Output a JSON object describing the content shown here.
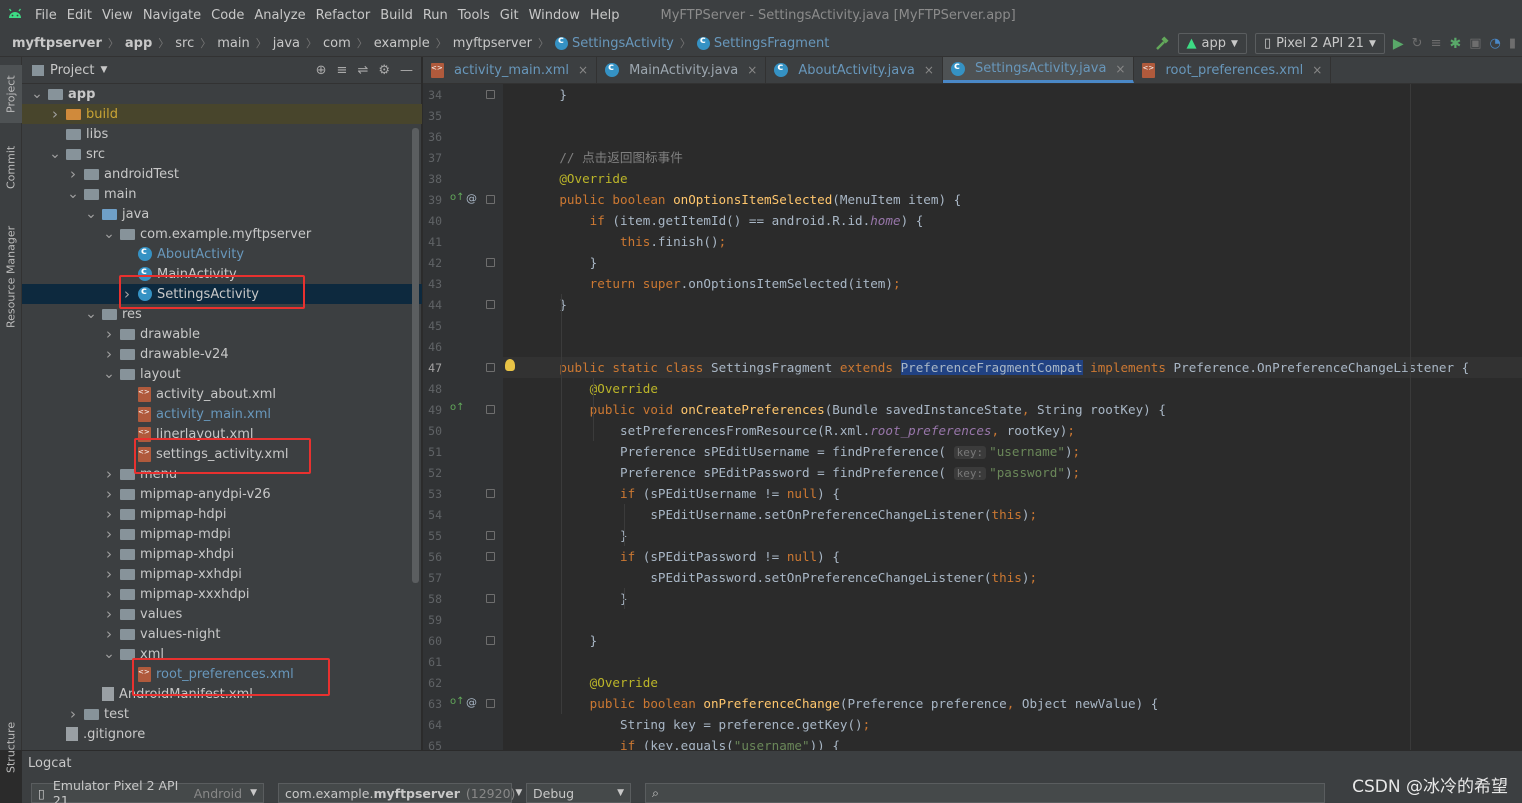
{
  "menu": {
    "items": [
      "File",
      "Edit",
      "View",
      "Navigate",
      "Code",
      "Analyze",
      "Refactor",
      "Build",
      "Run",
      "Tools",
      "Git",
      "Window",
      "Help"
    ],
    "window_title": "MyFTPServer - SettingsActivity.java [MyFTPServer.app]"
  },
  "breadcrumb": [
    "myftpserver",
    "app",
    "src",
    "main",
    "java",
    "com",
    "example",
    "myftpserver",
    "SettingsActivity",
    "SettingsFragment"
  ],
  "toolbar": {
    "run_config": "app",
    "device": "Pixel 2 API 21"
  },
  "left_strip": [
    "Project",
    "Commit",
    "Resource Manager",
    "Structure"
  ],
  "project": {
    "title": "Project"
  },
  "tree": [
    {
      "label": "app",
      "level": 1,
      "arrow": "v",
      "icon": "folder",
      "bold": true
    },
    {
      "label": "build",
      "level": 2,
      "arrow": ">",
      "icon": "folder-orange",
      "color": "yel"
    },
    {
      "label": "libs",
      "level": 2,
      "arrow": "",
      "icon": "folder"
    },
    {
      "label": "src",
      "level": 2,
      "arrow": "v",
      "icon": "folder"
    },
    {
      "label": "androidTest",
      "level": 3,
      "arrow": ">",
      "icon": "folder"
    },
    {
      "label": "main",
      "level": 3,
      "arrow": "v",
      "icon": "folder"
    },
    {
      "label": "java",
      "level": 4,
      "arrow": "v",
      "icon": "folder-blue"
    },
    {
      "label": "com.example.myftpserver",
      "level": 5,
      "arrow": "v",
      "icon": "folder"
    },
    {
      "label": "AboutActivity",
      "level": 6,
      "arrow": "",
      "icon": "java",
      "color": "blue"
    },
    {
      "label": "MainActivity",
      "level": 6,
      "arrow": "",
      "icon": "java"
    },
    {
      "label": "SettingsActivity",
      "level": 6,
      "arrow": ">",
      "icon": "java",
      "selected": true
    },
    {
      "label": "res",
      "level": 4,
      "arrow": "v",
      "icon": "folder"
    },
    {
      "label": "drawable",
      "level": 5,
      "arrow": ">",
      "icon": "folder"
    },
    {
      "label": "drawable-v24",
      "level": 5,
      "arrow": ">",
      "icon": "folder"
    },
    {
      "label": "layout",
      "level": 5,
      "arrow": "v",
      "icon": "folder"
    },
    {
      "label": "activity_about.xml",
      "level": 6,
      "arrow": "",
      "icon": "xml"
    },
    {
      "label": "activity_main.xml",
      "level": 6,
      "arrow": "",
      "icon": "xml",
      "color": "blue"
    },
    {
      "label": "linerlayout.xml",
      "level": 6,
      "arrow": "",
      "icon": "xml"
    },
    {
      "label": "settings_activity.xml",
      "level": 6,
      "arrow": "",
      "icon": "xml"
    },
    {
      "label": "menu",
      "level": 5,
      "arrow": ">",
      "icon": "folder"
    },
    {
      "label": "mipmap-anydpi-v26",
      "level": 5,
      "arrow": ">",
      "icon": "folder"
    },
    {
      "label": "mipmap-hdpi",
      "level": 5,
      "arrow": ">",
      "icon": "folder"
    },
    {
      "label": "mipmap-mdpi",
      "level": 5,
      "arrow": ">",
      "icon": "folder"
    },
    {
      "label": "mipmap-xhdpi",
      "level": 5,
      "arrow": ">",
      "icon": "folder"
    },
    {
      "label": "mipmap-xxhdpi",
      "level": 5,
      "arrow": ">",
      "icon": "folder"
    },
    {
      "label": "mipmap-xxxhdpi",
      "level": 5,
      "arrow": ">",
      "icon": "folder"
    },
    {
      "label": "values",
      "level": 5,
      "arrow": ">",
      "icon": "folder"
    },
    {
      "label": "values-night",
      "level": 5,
      "arrow": ">",
      "icon": "folder"
    },
    {
      "label": "xml",
      "level": 5,
      "arrow": "v",
      "icon": "folder"
    },
    {
      "label": "root_preferences.xml",
      "level": 6,
      "arrow": "",
      "icon": "xml",
      "color": "blue"
    },
    {
      "label": "AndroidManifest.xml",
      "level": 4,
      "arrow": "",
      "icon": "file"
    },
    {
      "label": "test",
      "level": 3,
      "arrow": ">",
      "icon": "folder"
    },
    {
      "label": ".gitignore",
      "level": 2,
      "arrow": "",
      "icon": "file"
    }
  ],
  "tabs": [
    {
      "label": "activity_main.xml",
      "icon": "xml",
      "color": "blue"
    },
    {
      "label": "MainActivity.java",
      "icon": "java"
    },
    {
      "label": "AboutActivity.java",
      "icon": "java",
      "color": "blue"
    },
    {
      "label": "SettingsActivity.java",
      "icon": "java",
      "active": true,
      "color": "blue"
    },
    {
      "label": "root_preferences.xml",
      "icon": "xml",
      "color": "blue"
    }
  ],
  "code": [
    {
      "n": 34,
      "html": "<span>    }</span>"
    },
    {
      "n": 35,
      "html": ""
    },
    {
      "n": 36,
      "html": ""
    },
    {
      "n": 37,
      "html": "<span class='cm'>    // 点击返回图标事件</span>"
    },
    {
      "n": 38,
      "html": "<span class='an'>    @Override</span>"
    },
    {
      "n": 39,
      "html": "<span class='kw'>    public boolean </span><span class='fn'>onOptionsItemSelected</span>(MenuItem item) {"
    },
    {
      "n": 40,
      "html": "        <span class='kw'>if </span>(item.getItemId() == android.R.id.<span class='it'>home</span>) {"
    },
    {
      "n": 41,
      "html": "            <span class='kw'>this</span>.finish()<span class='kw'>;</span>"
    },
    {
      "n": 42,
      "html": "        }"
    },
    {
      "n": 43,
      "html": "        <span class='kw'>return super</span>.onOptionsItemSelected(item)<span class='kw'>;</span>"
    },
    {
      "n": 44,
      "html": "    }"
    },
    {
      "n": 45,
      "html": ""
    },
    {
      "n": 46,
      "html": ""
    },
    {
      "n": 47,
      "html": "<span class='kw'>    public static class </span>SettingsFragment <span class='kw'>extends </span><span class='selw'>PreferenceFragmentCompat</span> <span class='kw'>implements </span>Preference.OnPreferenceChangeListener {"
    },
    {
      "n": 48,
      "html": "<span class='an'>        @Override</span>"
    },
    {
      "n": 49,
      "html": "<span class='kw'>        public void </span><span class='fn'>onCreatePreferences</span>(Bundle savedInstanceState<span class='kw'>, </span>String rootKey) {"
    },
    {
      "n": 50,
      "html": "            setPreferencesFromResource(R.xml.<span class='it'>root_preferences</span><span class='kw'>, </span>rootKey)<span class='kw'>;</span>"
    },
    {
      "n": 51,
      "html": "            Preference sPEditUsername = findPreference( <span class='hint'>key:</span><span class='st'>\"username\"</span>)<span class='kw'>;</span>"
    },
    {
      "n": 52,
      "html": "            Preference sPEditPassword = findPreference( <span class='hint'>key:</span><span class='st'>\"password\"</span>)<span class='kw'>;</span>"
    },
    {
      "n": 53,
      "html": "            <span class='kw'>if </span>(sPEditUsername != <span class='kw'>null</span>) {"
    },
    {
      "n": 54,
      "html": "                sPEditUsername.setOnPreferenceChangeListener(<span class='kw'>this</span>)<span class='kw'>;</span>"
    },
    {
      "n": 55,
      "html": "            }"
    },
    {
      "n": 56,
      "html": "            <span class='kw'>if </span>(sPEditPassword != <span class='kw'>null</span>) {"
    },
    {
      "n": 57,
      "html": "                sPEditPassword.setOnPreferenceChangeListener(<span class='kw'>this</span>)<span class='kw'>;</span>"
    },
    {
      "n": 58,
      "html": "            }"
    },
    {
      "n": 59,
      "html": ""
    },
    {
      "n": 60,
      "html": "        }"
    },
    {
      "n": 61,
      "html": ""
    },
    {
      "n": 62,
      "html": "<span class='an'>        @Override</span>"
    },
    {
      "n": 63,
      "html": "<span class='kw'>        public boolean </span><span class='fn'>onPreferenceChange</span>(Preference preference<span class='kw'>, </span>Object newValue) {"
    },
    {
      "n": 64,
      "html": "            String key = preference.getKey()<span class='kw'>;</span>"
    },
    {
      "n": 65,
      "html": "            <span class='kw'>if </span>(key.equals(<span class='st'>\"username\"</span>)) {"
    }
  ],
  "logcat": {
    "title": "Logcat",
    "device": "Emulator Pixel 2 API 21",
    "device_suffix": "Android",
    "process_prefix": "com.example.",
    "process_bold": "myftpserver",
    "process_pid": "(12920)",
    "level": "Debug"
  },
  "watermark": "CSDN @冰冷的希望",
  "colors": {
    "accent": "#4a88c7",
    "annotation_box": "#e8312f",
    "selection": "#0d293e"
  }
}
